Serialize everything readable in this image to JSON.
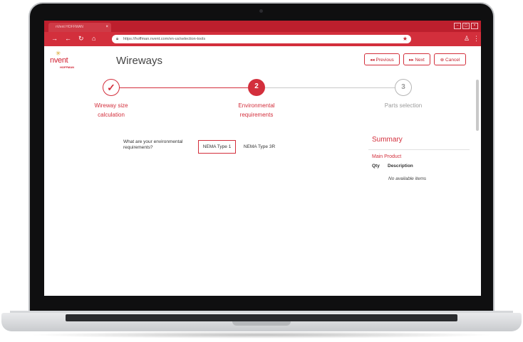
{
  "browser": {
    "tab_title": "nVent HOFFMAN",
    "tab_close": "×",
    "url": "https://hoffman.nvent.com/en-us/selection-tools",
    "window_buttons": [
      "–",
      "▢",
      "×"
    ]
  },
  "logo": {
    "brand": "nvent",
    "sub": "HOFFMAN"
  },
  "header": {
    "title": "Wireways",
    "previous_label": "Previous",
    "next_label": "Next",
    "cancel_label": "Cancel"
  },
  "steps": [
    {
      "number": "✓",
      "label_line1": "Wireway size",
      "label_line2": "calculation",
      "state": "completed"
    },
    {
      "number": "2",
      "label_line1": "Environmental",
      "label_line2": "requirements",
      "state": "active"
    },
    {
      "number": "3",
      "label_line1": "Parts selection",
      "label_line2": "",
      "state": "pending"
    }
  ],
  "form": {
    "question": "What are your environmental requirements?",
    "options": [
      "NEMA Type 1",
      "NEMA Type 3R"
    ],
    "selected": "NEMA Type 1"
  },
  "summary": {
    "title": "Summary",
    "product_heading": "Main Product",
    "col_qty": "Qty",
    "col_description": "Description",
    "empty_text": "No available items"
  },
  "colors": {
    "brand_red": "#d32f3c",
    "logo_gold": "#d9a52b",
    "pending_grey": "#9a9a9a"
  },
  "icons": [
    "forward-icon",
    "back-icon",
    "reload-icon",
    "home-icon",
    "lock-icon",
    "star-icon",
    "profile-icon",
    "menu-dots-icon",
    "rewind-icon",
    "fast-forward-icon",
    "cancel-circle-icon",
    "check-icon"
  ]
}
